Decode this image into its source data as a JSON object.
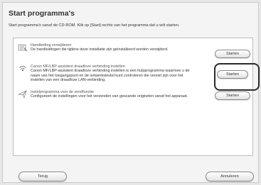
{
  "dialog": {
    "title": "Start programma's",
    "description": "Start programma's vanaf de CD-ROM. Klik op [Start] rechts van het programma dat u wilt starten."
  },
  "items": [
    {
      "title": "Handleiding verwijderen",
      "description": "De handleidingen die tijdens deze installatie zijn geïnstalleerd worden verwijderd.",
      "button_label": "Starten",
      "icon": "manual-uninstall-icon"
    },
    {
      "title": "Canon MF/LBP-assistent draadloze verbinding instellen",
      "description": "Canon MF/LBP-assistent draadloze verbinding instellen is een hulpprogramma waarmee u de naam van het toegangspunt en de netwerksleutel kunt controleren die vereist zijn voor het instellen van een draadloze LAN-verbinding.",
      "button_label": "Starten",
      "icon": "wireless-setup-icon"
    },
    {
      "title": "Instelprogramma voor de zendfunctie",
      "description": "Configureert de instellingen voor het verzenden van gescande originelen vanaf het apparaat.",
      "button_label": "Starten",
      "icon": "send-function-icon"
    }
  ],
  "footer": {
    "back_label": "Terug",
    "cancel_label": "Annuleren"
  }
}
